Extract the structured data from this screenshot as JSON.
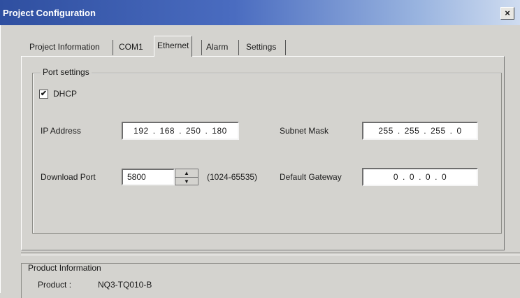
{
  "window": {
    "title": "Project Configuration",
    "close_glyph": "×"
  },
  "tabs": [
    {
      "label": "Project Information"
    },
    {
      "label": "COM1"
    },
    {
      "label": "Ethernet"
    },
    {
      "label": "Alarm"
    },
    {
      "label": "Settings"
    }
  ],
  "active_tab": "Ethernet",
  "port_settings": {
    "legend": "Port settings",
    "dhcp": {
      "label": "DHCP",
      "checked": true,
      "check_glyph": "✔"
    },
    "ip_address": {
      "label": "IP Address",
      "octets": [
        "192",
        "168",
        "250",
        "180"
      ]
    },
    "subnet_mask": {
      "label": "Subnet Mask",
      "octets": [
        "255",
        "255",
        "255",
        "0"
      ]
    },
    "download_port": {
      "label": "Download Port",
      "value": "5800",
      "range": "(1024-65535)"
    },
    "default_gateway": {
      "label": "Default Gateway",
      "octets": [
        "0",
        "0",
        "0",
        "0"
      ]
    }
  },
  "product_information": {
    "legend": "Product Information",
    "product_label": "Product :",
    "product_value": "NQ3-TQ010-B"
  },
  "colors": {
    "title_gradient_start": "#2f4fa0",
    "title_gradient_end": "#cfdcf0",
    "dialog_bg": "#d4d3cf"
  }
}
